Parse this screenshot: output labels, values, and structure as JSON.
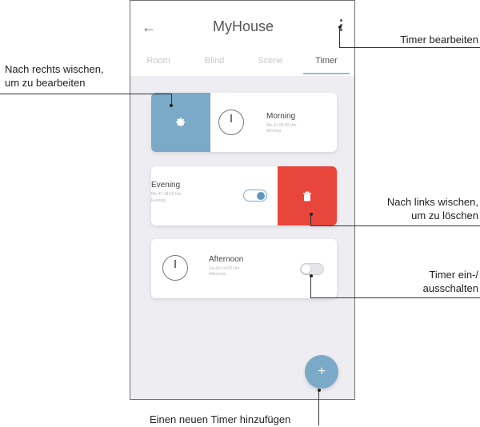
{
  "app": {
    "title": "MyHouse",
    "back_icon": "arrow-left-icon",
    "menu_icon": "more-vertical-icon"
  },
  "tabs": [
    {
      "label": "Room",
      "active": false
    },
    {
      "label": "Blind",
      "active": false
    },
    {
      "label": "Scene",
      "active": false
    },
    {
      "label": "Timer",
      "active": true
    }
  ],
  "timers": [
    {
      "name": "Morning",
      "subtitle_1": "Mo–Fr 06:30 Uhr",
      "subtitle_2": "Morning",
      "swipe_action": "edit",
      "action_color": "#7aaac8"
    },
    {
      "name": "Evening",
      "subtitle_1": "Mo–Fr 18:00 Uhr",
      "subtitle_2": "Evening",
      "enabled": true,
      "swipe_action": "delete",
      "action_color": "#e8453b"
    },
    {
      "name": "Afternoon",
      "subtitle_1": "Sa–So 14:00 Uhr",
      "subtitle_2": "Afternoon",
      "enabled": false
    }
  ],
  "fab": {
    "label": "+",
    "icon": "plus-icon"
  },
  "annotations": {
    "edit_timer": "Timer bearbeiten",
    "swipe_right_1": "Nach rechts wischen,",
    "swipe_right_2": "um zu bearbeiten",
    "swipe_left_1": "Nach links wischen,",
    "swipe_left_2": "um zu löschen",
    "toggle_1": "Timer ein-/",
    "toggle_2": "ausschalten",
    "add_new": "Einen neuen Timer hinzufügen"
  },
  "colors": {
    "accent": "#7aaac8",
    "danger": "#e8453b",
    "background": "#eeeef2"
  }
}
